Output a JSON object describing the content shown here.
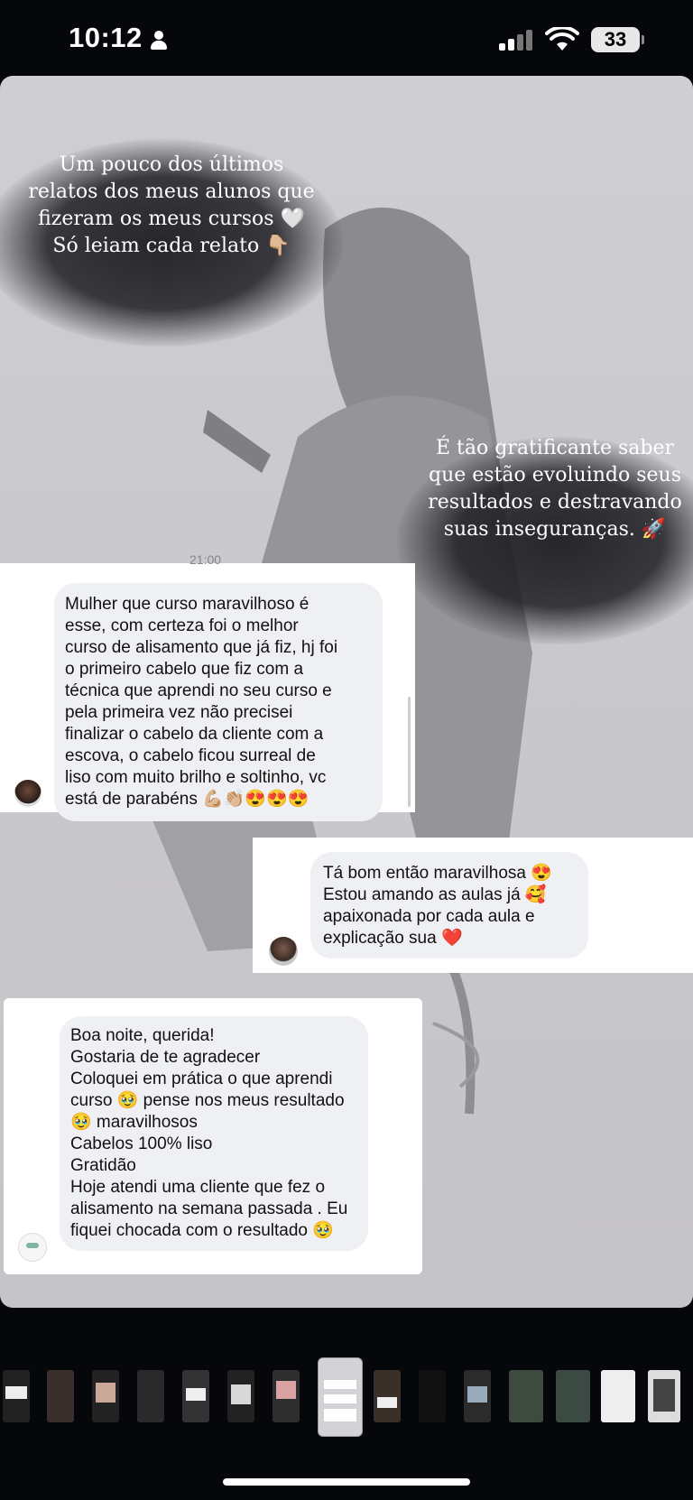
{
  "status_bar": {
    "time": "10:12",
    "battery": "33"
  },
  "story": {
    "caption_top": "Um pouco dos últimos\nrelatos dos meus alunos que\nfizeram os meus cursos 🤍\nSó leiam cada relato 👇🏼",
    "caption_right": "É tão gratificante saber\nque estão evoluindo seus\nresultados e destravando\nsuas inseguranças. 🚀",
    "message1": "Mulher que curso maravilhoso é\nesse, com certeza foi o melhor\ncurso de alisamento que já fiz, hj foi\no primeiro cabelo que fiz com a\ntécnica que aprendi no seu curso e\npela primeira vez não precisei\nfinalizar o cabelo da cliente com a\nescova, o cabelo ficou surreal de\nliso com muito brilho e soltinho, vc\nestá de parabéns 💪🏼👏🏼😍😍😍",
    "message1_partial_time": "21:00",
    "message2": "Tá bom então maravilhosa 😍\nEstou amando as aulas já 🥰\napaixonada por cada aula e\nexplicação sua ❤️",
    "message3": "Boa noite, querida!\nGostaria de te agradecer\nColoquei em prática o que aprendi\ncurso 🥹 pense nos meus resultado\n🥹 maravilhosos\nCabelos 100% liso\nGratidão\nHoje atendi uma cliente  que fez o\nalisamento na semana passada . Eu\nfiquei chocada com o resultado 🥹"
  },
  "thumbnails": {
    "count": 15,
    "active_index": 7
  },
  "colors": {
    "background": "#05070b",
    "story_bg": "#cfced2",
    "bubble": "#eef0f3"
  }
}
